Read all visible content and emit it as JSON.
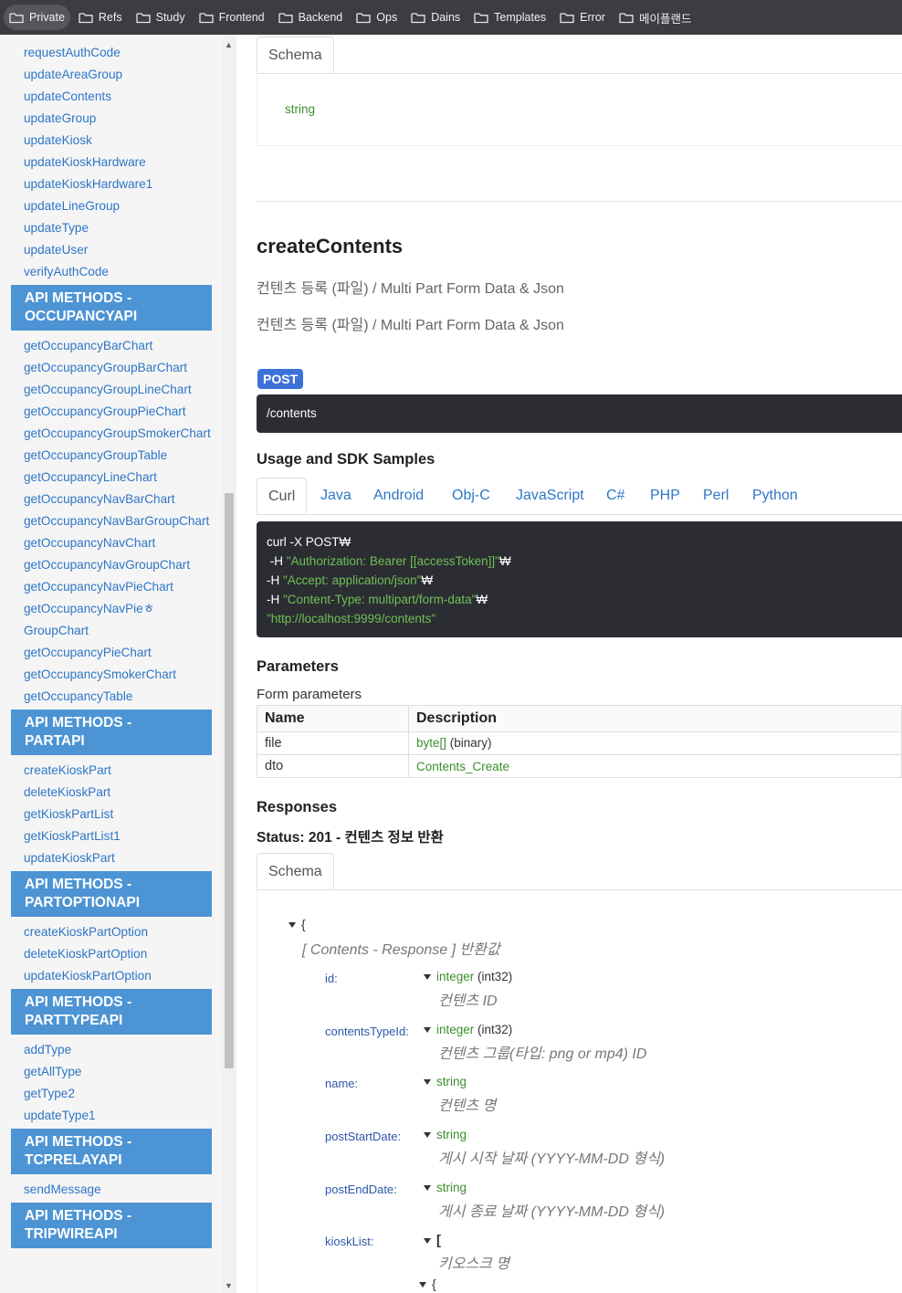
{
  "bookmarks": [
    {
      "label": "Private",
      "icon": "folder-icon"
    },
    {
      "label": "Refs",
      "icon": "folder-icon"
    },
    {
      "label": "Study",
      "icon": "folder-icon"
    },
    {
      "label": "Frontend",
      "icon": "folder-icon"
    },
    {
      "label": "Backend",
      "icon": "folder-icon"
    },
    {
      "label": "Ops",
      "icon": "folder-icon"
    },
    {
      "label": "Dains",
      "icon": "folder-icon"
    },
    {
      "label": "Templates",
      "icon": "folder-icon"
    },
    {
      "label": "Error",
      "icon": "folder-icon"
    },
    {
      "label": "메이플랜드",
      "icon": "folder-icon"
    }
  ],
  "sidebar": {
    "links_top": [
      "requestAuthCode",
      "updateAreaGroup",
      "updateContents",
      "updateGroup",
      "updateKiosk",
      "updateKioskHardware",
      "updateKioskHardware1",
      "updateLineGroup",
      "updateType",
      "updateUser",
      "verifyAuthCode"
    ],
    "groups": [
      {
        "header_line1": "API METHODS -",
        "header_line2": "OCCUPANCYAPI",
        "links": [
          "getOccupancyBarChart",
          "getOccupancyGroupBarChart",
          "getOccupancyGroupLineChart",
          "getOccupancyGroupPieChart",
          "getOccupancyGroupSmokerChart",
          "getOccupancyGroupTable",
          "getOccupancyLineChart",
          "getOccupancyNavBarChart",
          "getOccupancyNavBarGroupChart",
          "getOccupancyNavChart",
          "getOccupancyNavGroupChart",
          "getOccupancyNavPieChart",
          "getOccupancyNavPieㅎ",
          "GroupChart",
          "getOccupancyPieChart",
          "getOccupancySmokerChart",
          "getOccupancyTable"
        ]
      },
      {
        "header_line1": "API METHODS -",
        "header_line2": "PARTAPI",
        "links": [
          "createKioskPart",
          "deleteKioskPart",
          "getKioskPartList",
          "getKioskPartList1",
          "updateKioskPart"
        ]
      },
      {
        "header_line1": "API METHODS -",
        "header_line2": "PARTOPTIONAPI",
        "links": [
          "createKioskPartOption",
          "deleteKioskPartOption",
          "updateKioskPartOption"
        ]
      },
      {
        "header_line1": "API METHODS -",
        "header_line2": "PARTTYPEAPI",
        "links": [
          "addType",
          "getAllType",
          "getType2",
          "updateType1"
        ]
      },
      {
        "header_line1": "API METHODS -",
        "header_line2": "TCPRELAYAPI",
        "links": [
          "sendMessage"
        ]
      },
      {
        "header_line1": "API METHODS -",
        "header_line2": "TRIPWIREAPI",
        "links": []
      }
    ]
  },
  "main": {
    "top_schema_tab": "Schema",
    "top_schema_type": "string",
    "title": "createContents",
    "desc1": "컨텐츠 등록 (파일) / Multi Part Form Data & Json",
    "desc2": "컨텐츠 등록 (파일) / Multi Part Form Data & Json",
    "method": "POST",
    "path": "/contents",
    "sdk_title": "Usage and SDK Samples",
    "sdk_tabs": [
      "Curl",
      "Java",
      "Android",
      "Obj-C",
      "JavaScript",
      "C#",
      "PHP",
      "Perl",
      "Python"
    ],
    "code": {
      "line1": "curl -X POST₩",
      "line2_prefix": " -H ",
      "line2_str": "\"Authorization: Bearer [[accessToken]]\"",
      "line2_suffix": "₩",
      "line3_prefix": "-H ",
      "line3_str": "\"Accept: application/json\"",
      "line3_suffix": "₩",
      "line4_prefix": "-H ",
      "line4_str": "\"Content-Type: multipart/form-data\"",
      "line4_suffix": "₩",
      "line5_str": "\"http://localhost:9999/contents\""
    },
    "params_title": "Parameters",
    "form_params_label": "Form parameters",
    "params_headers": {
      "name": "Name",
      "description": "Description"
    },
    "params": [
      {
        "name": "file",
        "type": "byte[]",
        "extra": " (binary)"
      },
      {
        "name": "dto",
        "type": "Contents_Create",
        "extra": ""
      }
    ],
    "responses_title": "Responses",
    "status_line": "Status: 201 - 컨텐츠 정보 반환",
    "schema_tab": "Schema",
    "schema": {
      "open_brace": "{",
      "root_desc": "[ Contents - Response ] 반환값",
      "props": [
        {
          "name": "id:",
          "type": "integer",
          "fmt": " (int32)",
          "desc": "컨텐츠 ID"
        },
        {
          "name": "contentsTypeId:",
          "type": "integer",
          "fmt": " (int32)",
          "desc": "컨텐츠 그룹(타입: png or mp4) ID"
        },
        {
          "name": "name:",
          "type": "string",
          "fmt": "",
          "desc": "컨텐츠 명"
        },
        {
          "name": "postStartDate:",
          "type": "string",
          "fmt": "",
          "desc": "게시 시작 날짜 (YYYY-MM-DD 형식)"
        },
        {
          "name": "postEndDate:",
          "type": "string",
          "fmt": "",
          "desc": "게시 종료 날짜 (YYYY-MM-DD 형식)"
        },
        {
          "name": "kioskList:",
          "type": "[",
          "fmt": "",
          "desc": "키오스크 명"
        }
      ],
      "inner_brace": "{"
    }
  }
}
